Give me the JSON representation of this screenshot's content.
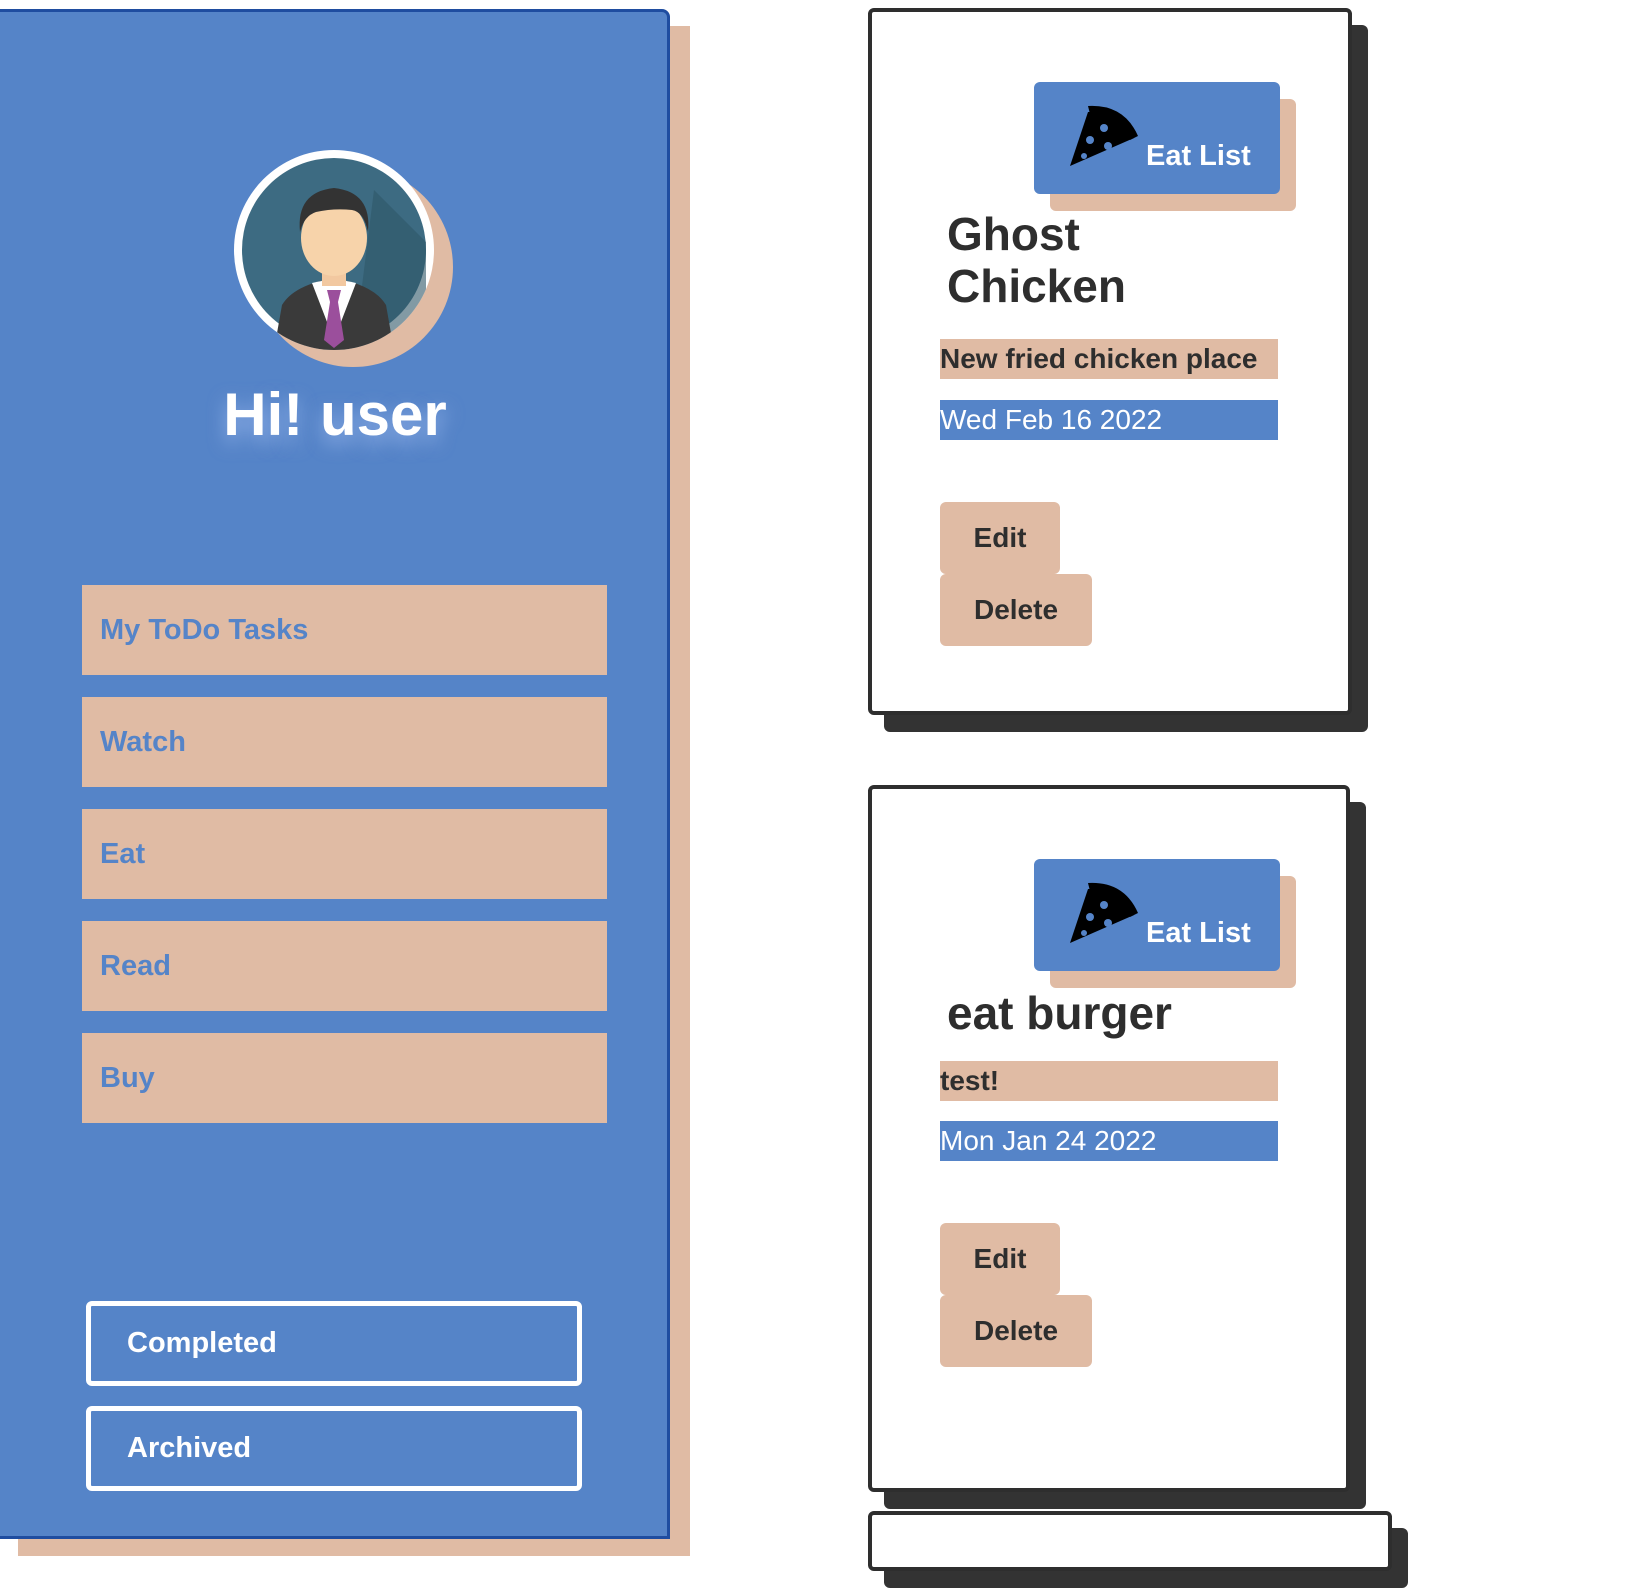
{
  "sidebar": {
    "greeting": "Hi! user",
    "avatar_icon": "user-avatar-icon",
    "nav_items": [
      {
        "label": "My ToDo Tasks"
      },
      {
        "label": "Watch"
      },
      {
        "label": "Eat"
      },
      {
        "label": "Read"
      },
      {
        "label": "Buy"
      }
    ],
    "completed_label": "Completed",
    "archived_label": "Archived"
  },
  "tasks": [
    {
      "category": "Eat List",
      "category_icon": "pizza-icon",
      "title": "Ghost Chicken",
      "description": "New fried chicken place",
      "date": "Wed Feb 16 2022",
      "edit_label": "Edit",
      "delete_label": "Delete"
    },
    {
      "category": "Eat List",
      "category_icon": "pizza-icon",
      "title": "eat burger",
      "description": "test!",
      "date": "Mon Jan 24 2022",
      "edit_label": "Edit",
      "delete_label": "Delete"
    }
  ],
  "colors": {
    "primary_blue": "#5584c8",
    "accent_beige": "#e0bba4",
    "dark": "#2e2e2e"
  }
}
